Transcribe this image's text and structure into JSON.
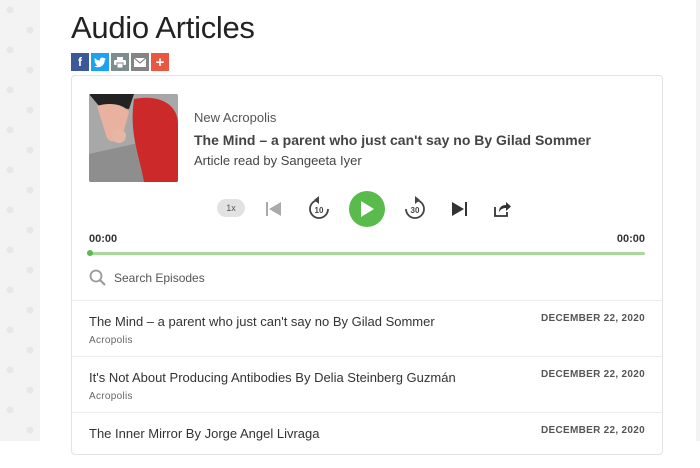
{
  "page": {
    "title": "Audio Articles"
  },
  "share": [
    {
      "icon": "facebook-icon",
      "glyph": "f",
      "color": "#3b5998"
    },
    {
      "icon": "twitter-icon",
      "glyph": "",
      "color": "#1da1f2"
    },
    {
      "icon": "print-icon",
      "glyph": "",
      "color": "#7f8c8d"
    },
    {
      "icon": "email-icon",
      "glyph": "",
      "color": "#848484"
    },
    {
      "icon": "plus-share-icon",
      "glyph": "+",
      "color": "#e8573f"
    }
  ],
  "player": {
    "podcast_name": "New Acropolis",
    "episode_title": "The Mind – a parent who just can't say no By Gilad Sommer",
    "episode_author": "Article read by Sangeeta Iyer",
    "speed": "1x",
    "rewind_seconds": "10",
    "forward_seconds": "30",
    "current_time": "00:00",
    "duration": "00:00",
    "progress": 0,
    "accent_color": "#59bb4b",
    "search_placeholder": "Search Episodes"
  },
  "episodes": [
    {
      "title": "The Mind – a parent who just can't say no By Gilad Sommer",
      "source": "Acropolis",
      "date": "DECEMBER 22, 2020"
    },
    {
      "title": "It's Not About Producing Antibodies By Delia Steinberg Guzmán",
      "source": "Acropolis",
      "date": "DECEMBER 22, 2020"
    },
    {
      "title": "The Inner Mirror By Jorge Angel Livraga",
      "source": "",
      "date": "DECEMBER 22, 2020"
    }
  ]
}
